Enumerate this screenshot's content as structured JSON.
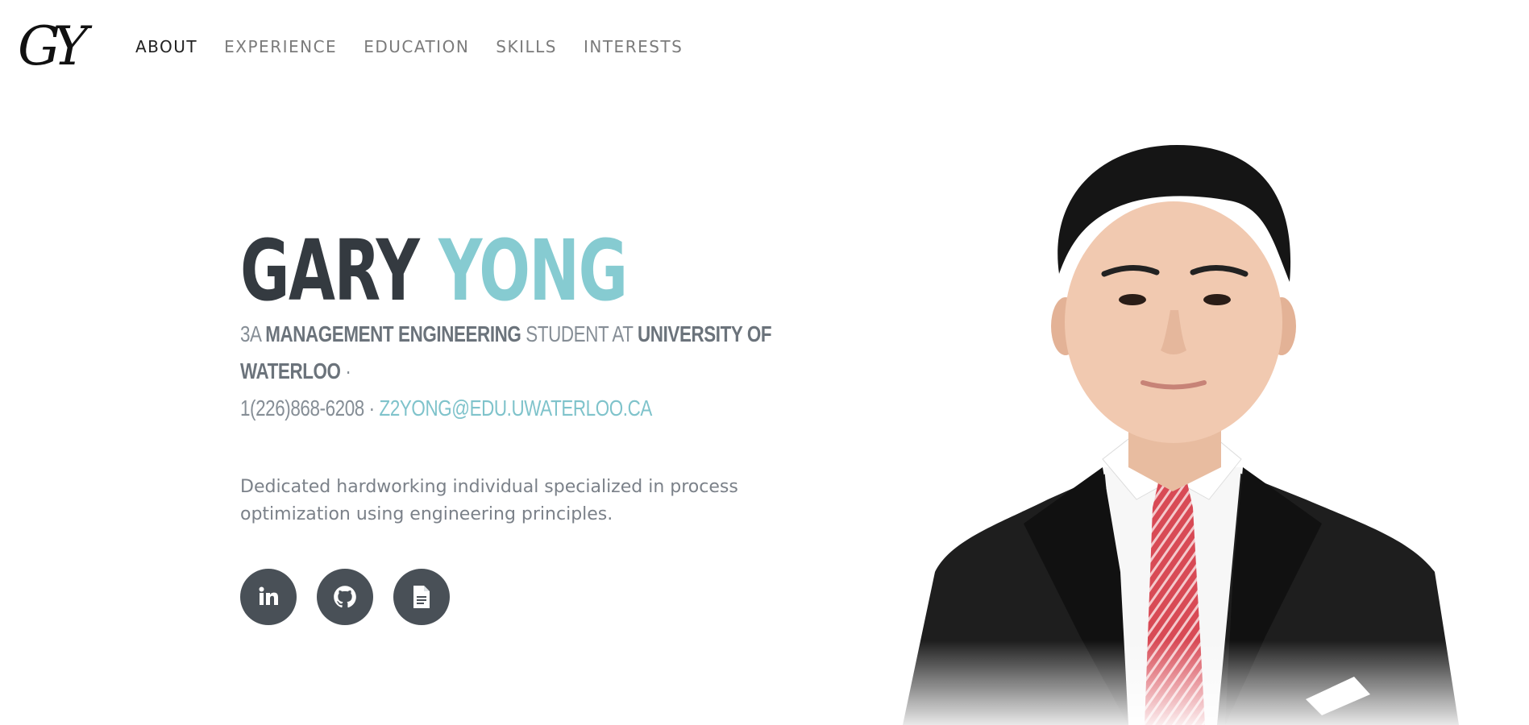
{
  "nav": {
    "logo_text": "GY",
    "links": [
      "ABOUT",
      "EXPERIENCE",
      "EDUCATION",
      "SKILLS",
      "INTERESTS"
    ]
  },
  "hero": {
    "first_name": "GARY",
    "last_name": "YONG",
    "subhead": {
      "year": "3A",
      "program": "MANAGEMENT ENGINEERING",
      "student_at": "STUDENT AT",
      "school": "UNIVERSITY OF WATERLOO",
      "separator": "·",
      "phone": "1(226)868-6208",
      "email": "Z2YONG@EDU.UWATERLOO.CA"
    },
    "bio": "Dedicated hardworking individual specialized in process optimization using engineering principles."
  },
  "social": {
    "icons": [
      "linkedin-icon",
      "github-icon",
      "resume-document-icon"
    ]
  },
  "colors": {
    "accent": "#86cbd1",
    "dark": "#343a40",
    "muted": "#868e96",
    "button_bg": "#495057"
  }
}
